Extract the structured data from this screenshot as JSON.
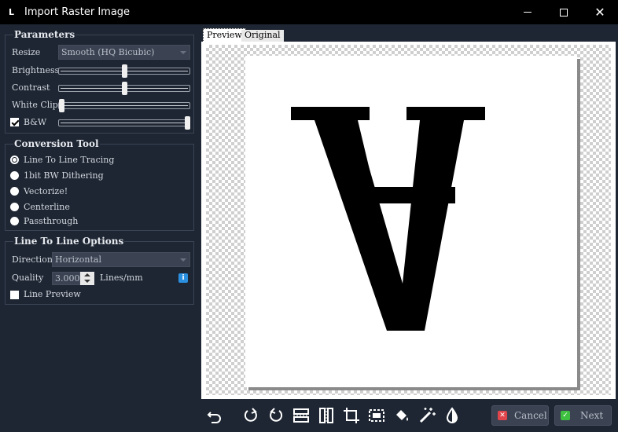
{
  "window": {
    "title": "Import Raster Image"
  },
  "parameters": {
    "title": "Parameters",
    "resize_label": "Resize",
    "resize_value": "Smooth (HQ Bicubic)",
    "brightness_label": "Brightness",
    "brightness_level": 0.5,
    "contrast_label": "Contrast",
    "contrast_level": 0.5,
    "white_clip_label": "White Clip",
    "white_clip_level": 0.0,
    "bw_label": "B&W",
    "bw_checked": true,
    "bw_level": 1.0
  },
  "conversion": {
    "title": "Conversion Tool",
    "options": [
      {
        "label": "Line To Line Tracing",
        "selected": true
      },
      {
        "label": "1bit BW Dithering",
        "selected": false
      },
      {
        "label": "Vectorize!",
        "selected": false
      },
      {
        "label": "Centerline",
        "selected": false
      },
      {
        "label": "Passthrough",
        "selected": false
      }
    ]
  },
  "line_options": {
    "title": "Line To Line Options",
    "direction_label": "Direction",
    "direction_value": "Horizontal",
    "quality_label": "Quality",
    "quality_value": "3.000",
    "quality_unit": "Lines/mm",
    "line_preview_label": "Line Preview",
    "line_preview_checked": false
  },
  "preview": {
    "tabs": [
      {
        "label": "Preview",
        "active": true
      },
      {
        "label": "Original",
        "active": false
      }
    ]
  },
  "toolbar": {
    "tools": [
      "undo-icon",
      "rotate-clockwise-icon",
      "rotate-counterclockwise-icon",
      "flip-vertical-icon",
      "flip-horizontal-icon",
      "crop-icon",
      "auto-crop-icon",
      "fill-bucket-icon",
      "magic-wand-icon",
      "invert-icon"
    ],
    "cancel_label": "Cancel",
    "next_label": "Next"
  },
  "colors": {
    "background": "#1e2633",
    "cancel_icon": "#e0454b",
    "next_icon": "#3fbf3f",
    "info": "#2b8fe0"
  }
}
